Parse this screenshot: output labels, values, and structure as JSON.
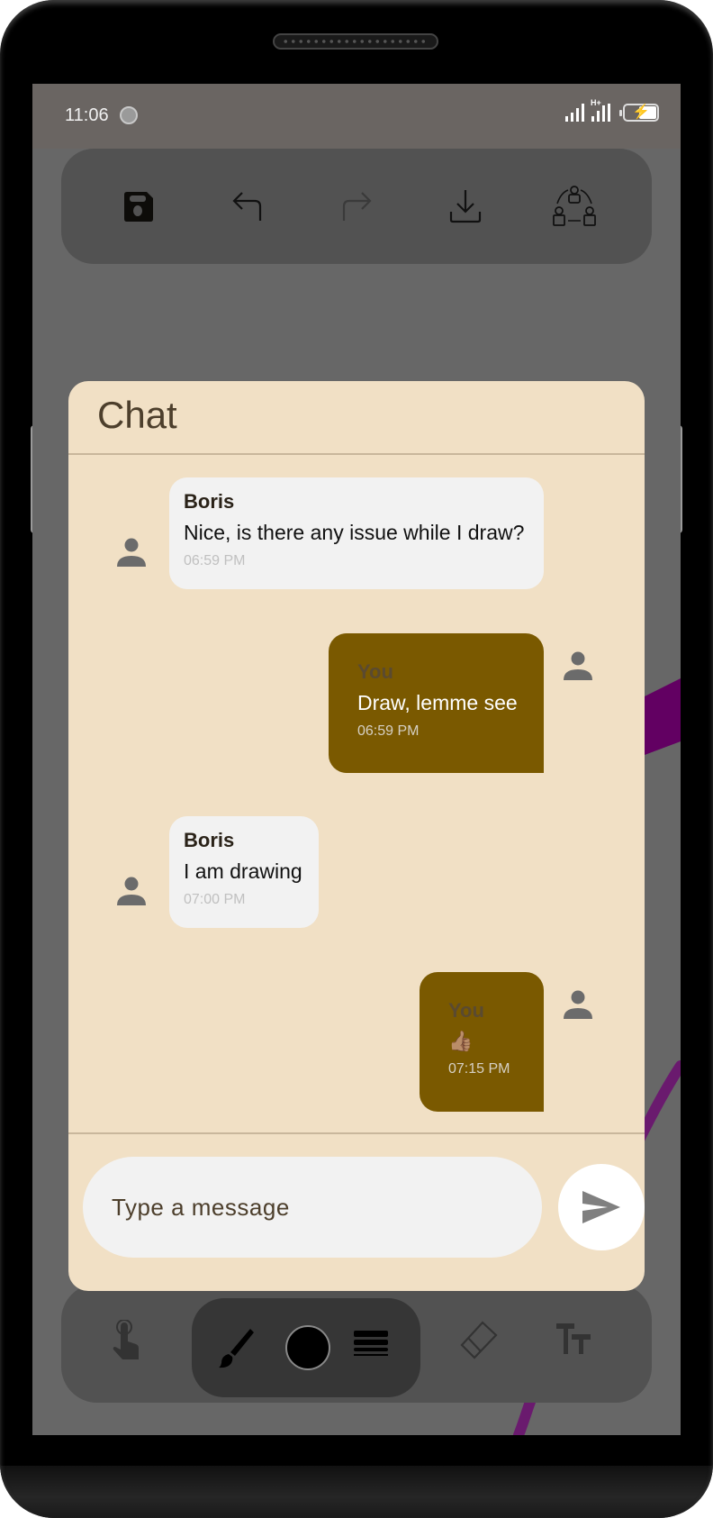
{
  "status_bar": {
    "time": "11:06",
    "network_label": "H+",
    "icons": [
      "sync-spinner-icon",
      "signal-icon",
      "hplus-signal-icon",
      "battery-charging-icon"
    ]
  },
  "top_toolbar": {
    "buttons": [
      {
        "name": "save",
        "icon": "floppy-disk-icon",
        "enabled": true
      },
      {
        "name": "undo",
        "icon": "undo-arrow-icon",
        "enabled": true
      },
      {
        "name": "redo",
        "icon": "redo-arrow-icon",
        "enabled": false
      },
      {
        "name": "download",
        "icon": "download-icon",
        "enabled": true
      },
      {
        "name": "collaborate",
        "icon": "collaboration-users-icon",
        "enabled": true
      }
    ]
  },
  "bottom_toolbar": {
    "buttons": [
      {
        "name": "pointer",
        "icon": "touch-hand-icon"
      },
      {
        "name": "brush",
        "icon": "paintbrush-icon",
        "selected": true
      },
      {
        "name": "color",
        "icon": "color-swatch-icon",
        "value": "#000000"
      },
      {
        "name": "stroke-width",
        "icon": "line-weight-icon"
      },
      {
        "name": "eraser",
        "icon": "eraser-icon"
      },
      {
        "name": "text",
        "icon": "text-size-icon"
      }
    ]
  },
  "chat": {
    "title": "Chat",
    "messages": [
      {
        "sender": "Boris",
        "text": "Nice, is there any issue while I draw?",
        "time": "06:59 PM",
        "direction": "incoming"
      },
      {
        "sender": "You",
        "text": "Draw, lemme see",
        "time": "06:59 PM",
        "direction": "outgoing"
      },
      {
        "sender": "Boris",
        "text": "I am drawing",
        "time": "07:00 PM",
        "direction": "incoming"
      },
      {
        "sender": "You",
        "text": "👍🏽",
        "time": "07:15 PM",
        "direction": "outgoing"
      }
    ],
    "input": {
      "value": "",
      "placeholder": "Type a message"
    },
    "send_icon": "send-icon"
  },
  "colors": {
    "chat_bg": "#f1e0c5",
    "incoming_bubble": "#f2f2f2",
    "outgoing_bubble": "#7a5900",
    "canvas_stroke": "#6a0b6e",
    "title_text": "#4d3f2c"
  }
}
